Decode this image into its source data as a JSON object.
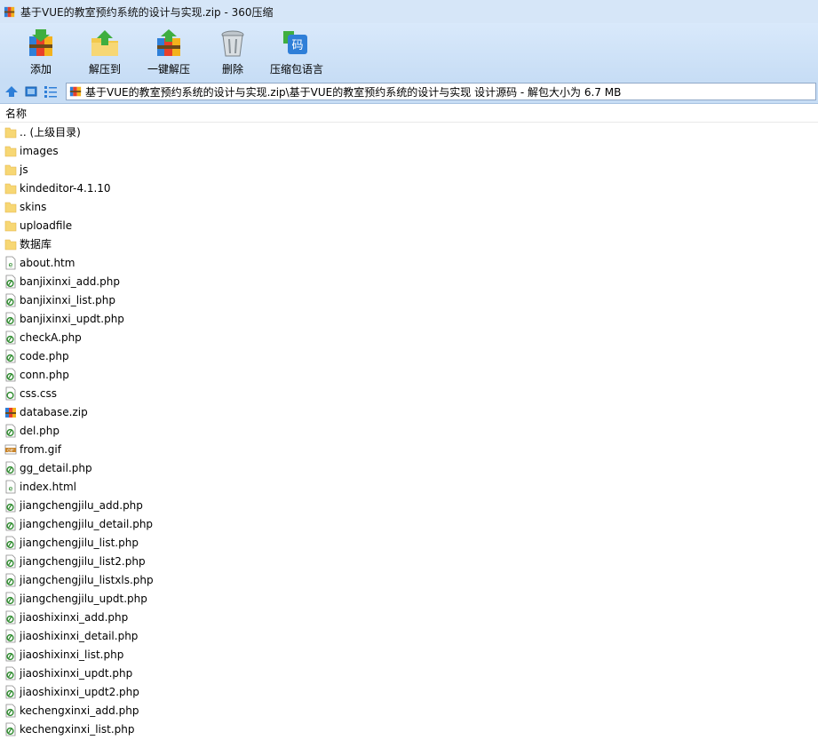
{
  "window": {
    "title": "基于VUE的教室预约系统的设计与实现.zip - 360压缩"
  },
  "toolbar": {
    "add_label": "添加",
    "extract_to_label": "解压到",
    "one_click_extract_label": "一键解压",
    "delete_label": "删除",
    "language_label": "压缩包语言",
    "language_icon_text": "码"
  },
  "address": {
    "path": "基于VUE的教室预约系统的设计与实现.zip\\基于VUE的教室预约系统的设计与实现 设计源码 - 解包大小为 6.7 MB"
  },
  "columns": {
    "name_header": "名称"
  },
  "files": [
    {
      "name": ".. (上级目录)",
      "type": "folder"
    },
    {
      "name": "images",
      "type": "folder"
    },
    {
      "name": "js",
      "type": "folder"
    },
    {
      "name": "kindeditor-4.1.10",
      "type": "folder"
    },
    {
      "name": "skins",
      "type": "folder"
    },
    {
      "name": "uploadfile",
      "type": "folder"
    },
    {
      "name": "数据库",
      "type": "folder"
    },
    {
      "name": "about.htm",
      "type": "html"
    },
    {
      "name": "banjixinxi_add.php",
      "type": "php"
    },
    {
      "name": "banjixinxi_list.php",
      "type": "php"
    },
    {
      "name": "banjixinxi_updt.php",
      "type": "php"
    },
    {
      "name": "checkA.php",
      "type": "php"
    },
    {
      "name": "code.php",
      "type": "php"
    },
    {
      "name": "conn.php",
      "type": "php"
    },
    {
      "name": "css.css",
      "type": "css"
    },
    {
      "name": "database.zip",
      "type": "zip"
    },
    {
      "name": "del.php",
      "type": "php"
    },
    {
      "name": "from.gif",
      "type": "gif"
    },
    {
      "name": "gg_detail.php",
      "type": "php"
    },
    {
      "name": "index.html",
      "type": "html"
    },
    {
      "name": "jiangchengjilu_add.php",
      "type": "php"
    },
    {
      "name": "jiangchengjilu_detail.php",
      "type": "php"
    },
    {
      "name": "jiangchengjilu_list.php",
      "type": "php"
    },
    {
      "name": "jiangchengjilu_list2.php",
      "type": "php"
    },
    {
      "name": "jiangchengjilu_listxls.php",
      "type": "php"
    },
    {
      "name": "jiangchengjilu_updt.php",
      "type": "php"
    },
    {
      "name": "jiaoshixinxi_add.php",
      "type": "php"
    },
    {
      "name": "jiaoshixinxi_detail.php",
      "type": "php"
    },
    {
      "name": "jiaoshixinxi_list.php",
      "type": "php"
    },
    {
      "name": "jiaoshixinxi_updt.php",
      "type": "php"
    },
    {
      "name": "jiaoshixinxi_updt2.php",
      "type": "php"
    },
    {
      "name": "kechengxinxi_add.php",
      "type": "php"
    },
    {
      "name": "kechengxinxi_list.php",
      "type": "php"
    }
  ],
  "colors": {
    "titlebar": "#d6e6f8",
    "toolbar": "#c7ddf5",
    "folder": "#f7d774",
    "php_icon": "#2e8b2e"
  }
}
